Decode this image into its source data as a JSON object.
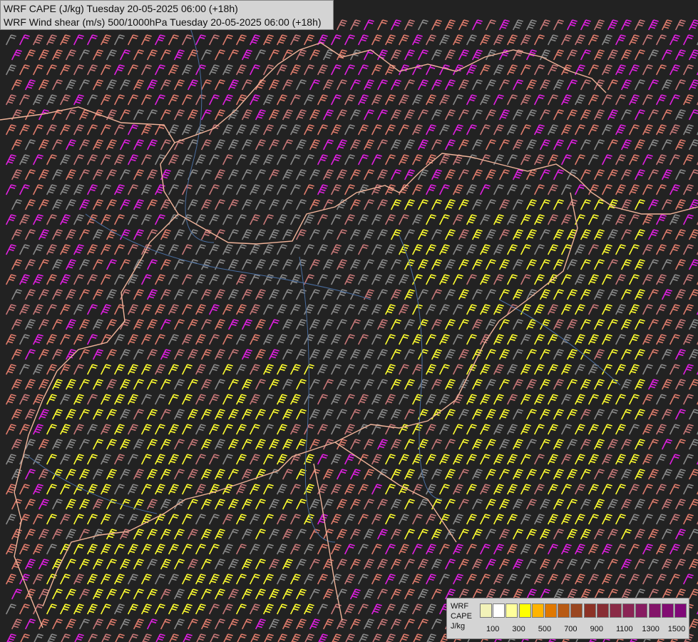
{
  "titles": {
    "line1": "WRF CAPE (J/kg) Tuesday 20-05-2025 06:00 (+18h)",
    "line2": "WRF Wind shear (m/s) 500/1000hPa Tuesday 20-05-2025 06:00 (+18h)"
  },
  "legend": {
    "labels": [
      "WRF",
      "CAPE",
      "J/kg"
    ],
    "ticks": [
      "100",
      "300",
      "500",
      "700",
      "900",
      "1100",
      "1300",
      "1500"
    ],
    "colors": [
      "#f2f2b8",
      "#ffffff",
      "#ffff9a",
      "#ffff00",
      "#ffb400",
      "#e07800",
      "#b85a14",
      "#9a4620",
      "#8c3226",
      "#882d34",
      "#8a2a46",
      "#8a2454",
      "#881c62",
      "#84146a",
      "#820c72",
      "#800878"
    ]
  },
  "field_colors": {
    "background": "#222222",
    "gray_barb": "#8a8a8a",
    "low_barb": "#c87878",
    "salmon_barb": "#e07c6c",
    "yellow_barb": "#ffff30",
    "magenta_barb": "#e020e0",
    "border": "#f0b49a",
    "river": "#4a6ea0"
  }
}
